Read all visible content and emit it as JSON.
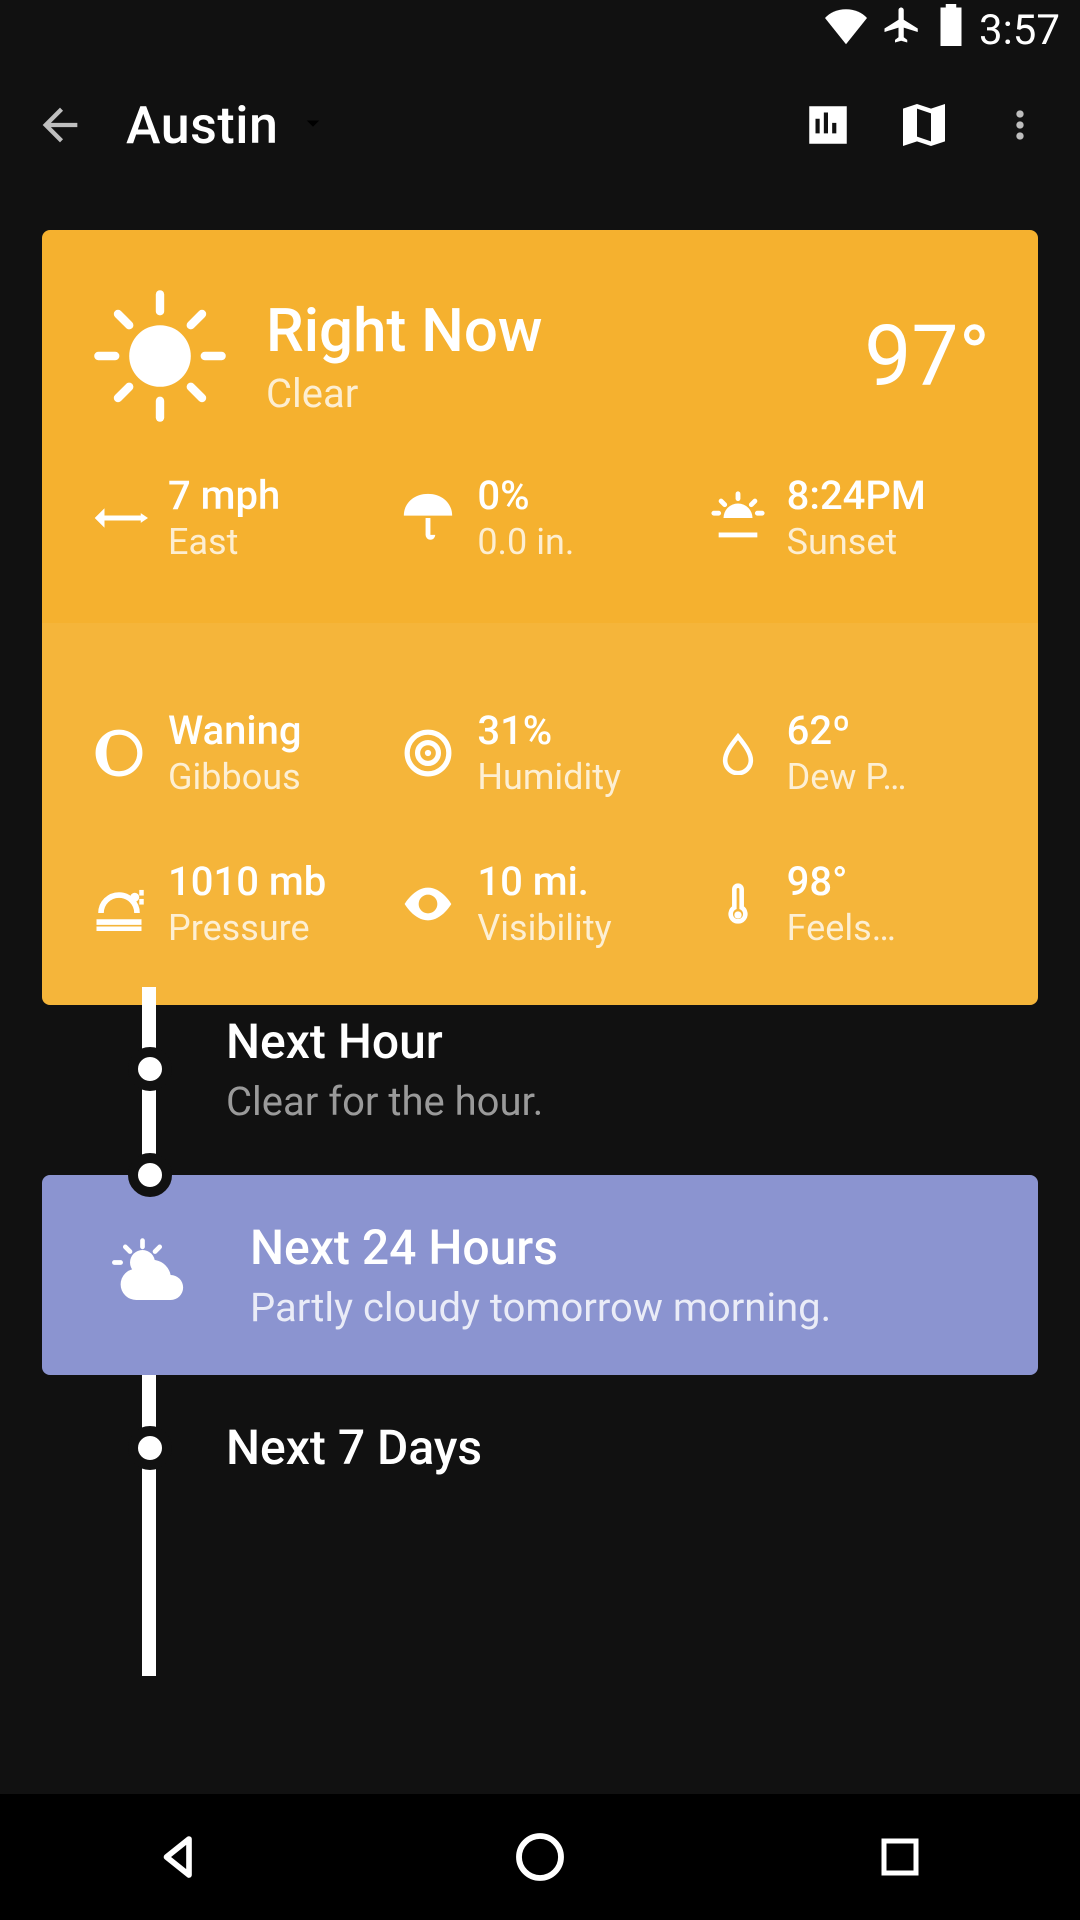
{
  "status_bar": {
    "time": "3:57"
  },
  "app_bar": {
    "location": "Austin"
  },
  "now": {
    "title": "Right Now",
    "condition": "Clear",
    "temperature": "97°",
    "wind": {
      "value": "7 mph",
      "label": "East"
    },
    "precip": {
      "value": "0%",
      "label": "0.0 in."
    },
    "sun": {
      "value": "8:24PM",
      "label": "Sunset"
    }
  },
  "details": {
    "moon": {
      "value": "Waning",
      "label": "Gibbous"
    },
    "humidity": {
      "value": "31%",
      "label": "Humidity"
    },
    "dewpoint": {
      "value": "62º",
      "label": "Dew P…"
    },
    "pressure": {
      "value": "1010 mb",
      "label": "Pressure"
    },
    "visibility": {
      "value": "10 mi.",
      "label": "Visibility"
    },
    "feelslike": {
      "value": "98°",
      "label": "Feels…"
    }
  },
  "timeline": {
    "next_hour": {
      "title": "Next Hour",
      "subtitle": "Clear for the hour."
    },
    "next_24": {
      "title": "Next 24 Hours",
      "subtitle": "Partly cloudy tomorrow morning."
    },
    "next_7_days": {
      "title": "Next 7 Days"
    }
  },
  "colors": {
    "card_bg": "#f5b12f",
    "next24_bg": "#8b94d0"
  }
}
